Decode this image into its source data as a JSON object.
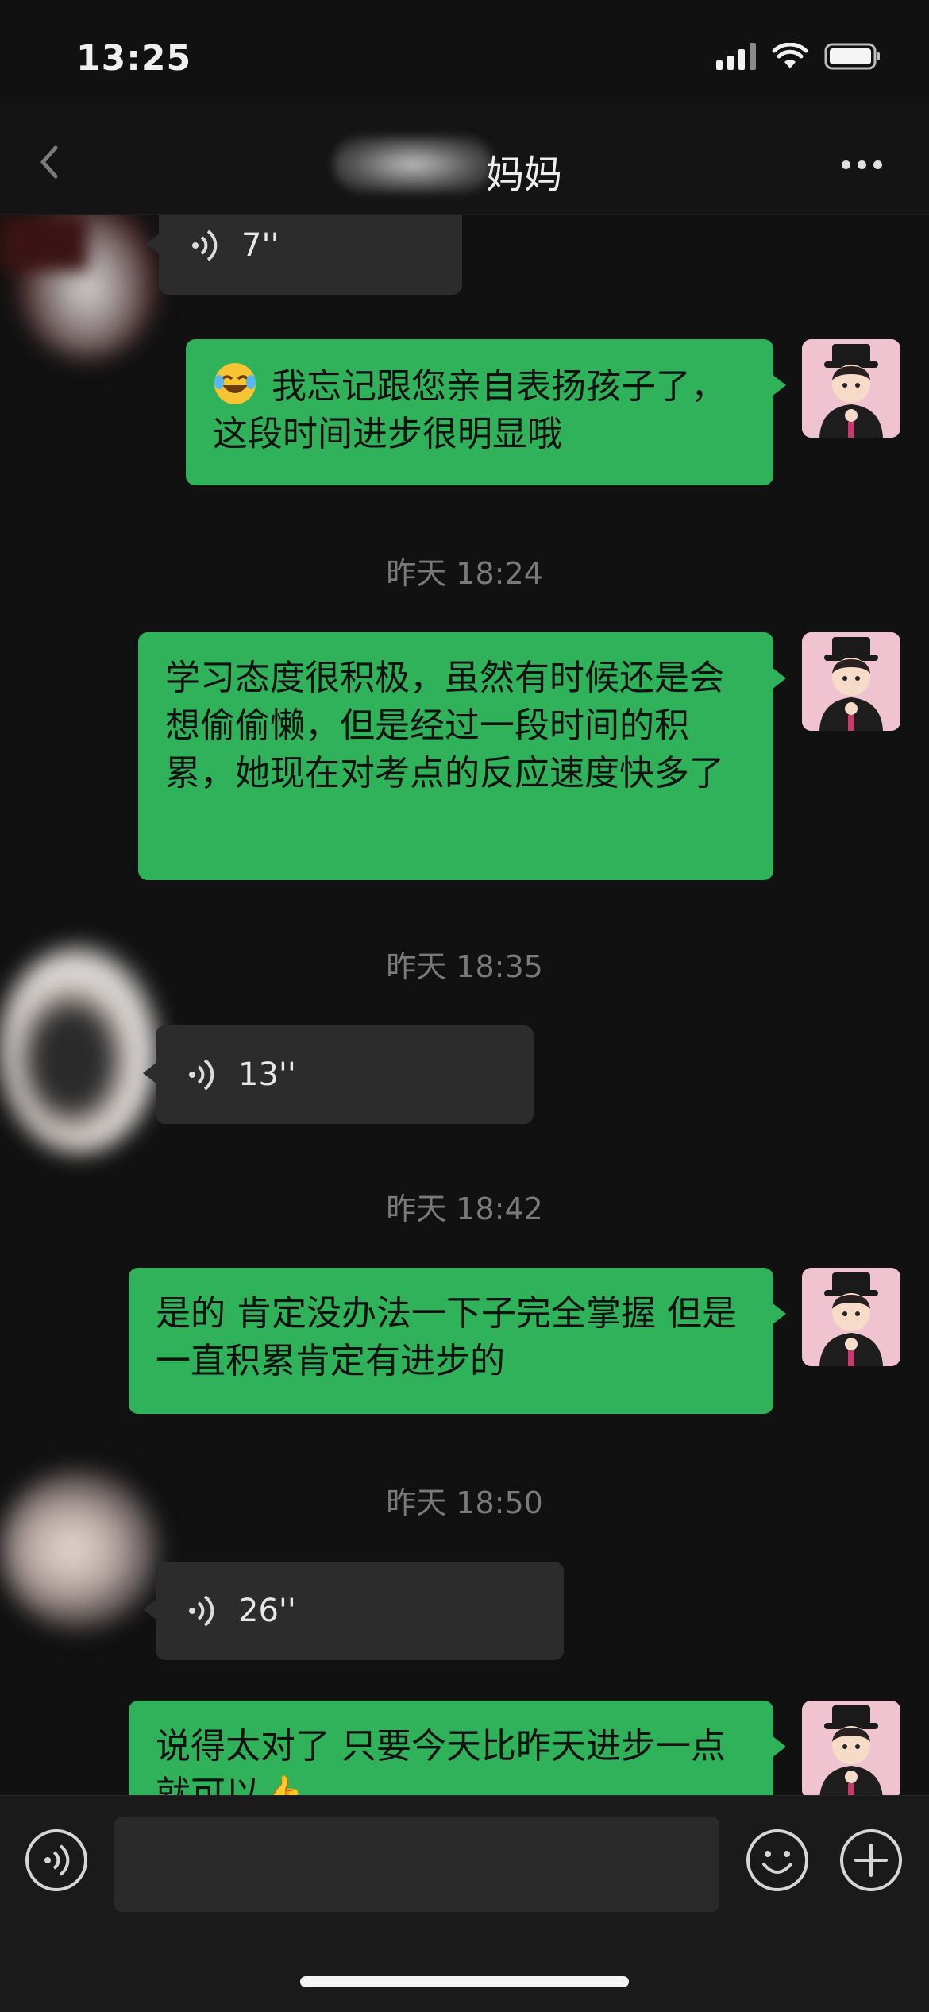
{
  "status_bar": {
    "time": "13:25",
    "icons": [
      "signal-icon",
      "wifi-icon",
      "battery-icon"
    ]
  },
  "nav": {
    "title": "妈妈",
    "back_icon": "chevron-left-icon",
    "more_icon": "more-icon"
  },
  "messages": [
    {
      "type": "voice",
      "direction": "in",
      "duration": "7''"
    },
    {
      "type": "text",
      "direction": "out",
      "emoji": "face-with-tears-of-joy-icon",
      "text": "我忘记跟您亲自表扬孩子了，这段时间进步很明显哦"
    },
    {
      "type": "timestamp",
      "text": "昨天 18:24"
    },
    {
      "type": "text",
      "direction": "out",
      "text": "学习态度很积极，虽然有时候还是会想偷偷懒，但是经过一段时间的积累，她现在对考点的反应速度快多了"
    },
    {
      "type": "timestamp",
      "text": "昨天 18:35"
    },
    {
      "type": "voice",
      "direction": "in",
      "duration": "13''"
    },
    {
      "type": "timestamp",
      "text": "昨天 18:42"
    },
    {
      "type": "text",
      "direction": "out",
      "text": "是的 肯定没办法一下子完全掌握 但是一直积累肯定有进步的"
    },
    {
      "type": "timestamp",
      "text": "昨天 18:50"
    },
    {
      "type": "voice",
      "direction": "in",
      "duration": "26''"
    },
    {
      "type": "text",
      "direction": "out",
      "text": "说得太对了 只要今天比昨天进步一点就可以👍"
    }
  ],
  "input_bar": {
    "voice_icon": "voice-mode-icon",
    "emoji_icon": "smiley-icon",
    "plus_icon": "plus-circle-icon",
    "placeholder": ""
  },
  "colors": {
    "background": "#111111",
    "outgoing_bubble": "#2fb25a",
    "incoming_bubble": "#2c2c2c",
    "timestamp": "#7a7a7a"
  }
}
